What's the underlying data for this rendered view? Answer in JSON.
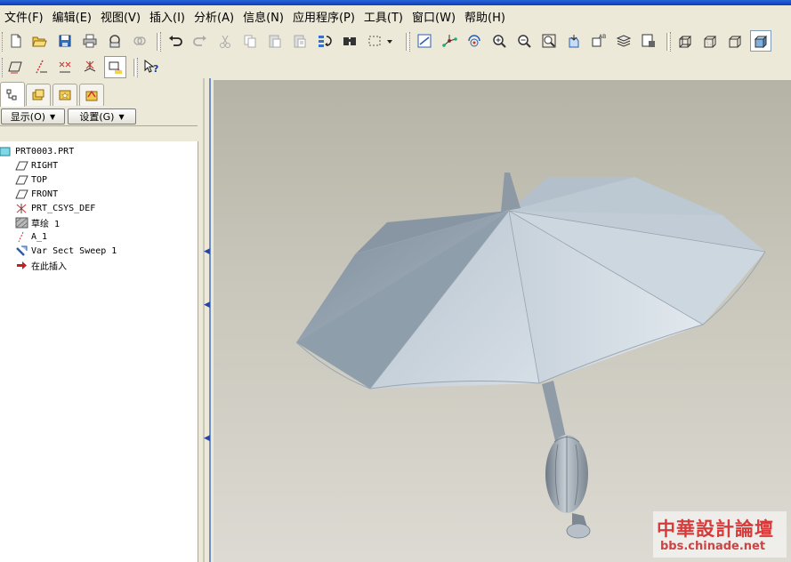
{
  "menu": [
    "文件(F)",
    "编辑(E)",
    "视图(V)",
    "插入(I)",
    "分析(A)",
    "信息(N)",
    "应用程序(P)",
    "工具(T)",
    "窗口(W)",
    "帮助(H)"
  ],
  "toolbar_icons": [
    "new-file-icon",
    "open-file-icon",
    "save-icon",
    "print-icon",
    "send-mail-icon",
    "link-icon",
    "undo-icon",
    "redo-icon",
    "cut-icon",
    "copy-icon",
    "paste-icon",
    "paste-special-icon",
    "regenerate-icon",
    "find-icon",
    "select-box-icon",
    "dropdown-arrow-icon",
    "repaint-icon",
    "spin-center-icon",
    "orientation-icon",
    "zoom-in-icon",
    "zoom-out-icon",
    "refit-icon",
    "reorient-icon",
    "saved-view-icon",
    "layers-icon",
    "view-manager-icon",
    "wireframe-icon",
    "hidden-line-icon",
    "no-hidden-icon",
    "shading-icon"
  ],
  "toolbar2_icons": [
    "datum-planes-icon",
    "datum-axes-icon",
    "datum-points-icon",
    "coordinate-systems-icon",
    "annotation-display-icon",
    "context-help-icon"
  ],
  "nav_tabs": [
    "model-tree-tab",
    "folder-browser-tab",
    "favorites-tab",
    "connections-tab"
  ],
  "tree_controls": {
    "show_label": "显示(O)",
    "settings_label": "设置(G)"
  },
  "model_tree": [
    {
      "label": "PRT0003.PRT",
      "icon": "part-icon"
    },
    {
      "label": "RIGHT",
      "icon": "datum-plane-icon"
    },
    {
      "label": "TOP",
      "icon": "datum-plane-icon"
    },
    {
      "label": "FRONT",
      "icon": "datum-plane-icon"
    },
    {
      "label": "PRT_CSYS_DEF",
      "icon": "csys-icon"
    },
    {
      "label": "草绘 1",
      "icon": "sketch-icon"
    },
    {
      "label": "A_1",
      "icon": "axis-icon"
    },
    {
      "label": "Var Sect Sweep 1",
      "icon": "sweep-icon"
    },
    {
      "label": "在此插入",
      "icon": "insert-here-icon"
    }
  ],
  "watermark": {
    "title": "中華設計論壇",
    "url": "bbs.chinade.net"
  },
  "colors": {
    "viewport_top": "#b4b3a5",
    "viewport_bottom": "#dcdad2",
    "model": "#a9b7c4",
    "accent": "#d63a3a"
  }
}
